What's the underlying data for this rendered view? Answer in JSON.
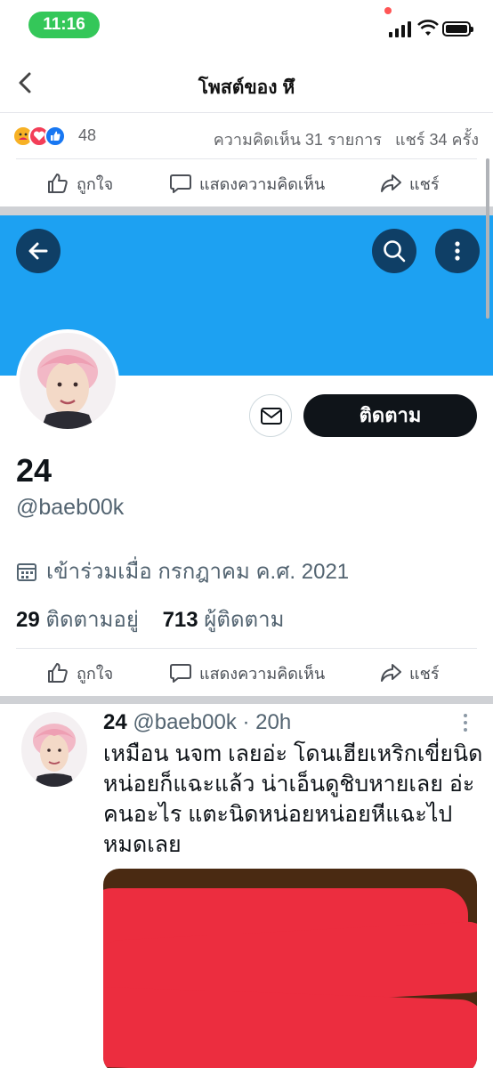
{
  "status_bar": {
    "time": "11:16"
  },
  "header": {
    "title": "โพสต์ของ หึ"
  },
  "reactions": {
    "count": "48",
    "comments_text": "ความคิดเห็น 31 รายการ",
    "shares_text": "แชร์ 34 ครั้ง"
  },
  "actions": {
    "like": "ถูกใจ",
    "comment": "แสดงความคิดเห็น",
    "share": "แชร์"
  },
  "profile": {
    "name": "24",
    "handle": "@baeb00k",
    "follow_label": "ติดตาม",
    "joined": "เข้าร่วมเมื่อ กรกฎาคม ค.ศ. 2021",
    "following_count": "29",
    "following_label": "ติดตามอยู่",
    "followers_count": "713",
    "followers_label": "ผู้ติดตาม"
  },
  "tweet": {
    "name": "24",
    "handle_time": "@baeb00k · 20h",
    "text": "เหมือน นจm เลยอ่ะ โดนเฮียเหริกเขี่ยนิดหน่อยก็แฉะแล้ว น่าเอ็นดูชิบหายเลย อ่ะคนอะไร แตะนิดหน่อยหน่อยหีแฉะไปหมดเลย"
  },
  "colors": {
    "twitter_blue": "#1da1f2",
    "dark_button": "#0f1419",
    "status_green": "#34c759",
    "redaction": "#ec2d3f"
  },
  "icons": [
    "back-chevron-icon",
    "like-icon",
    "love-icon",
    "care-icon",
    "thumbs-up-icon",
    "comment-icon",
    "share-icon",
    "arrow-left-icon",
    "search-icon",
    "more-vertical-icon",
    "mail-icon",
    "calendar-icon"
  ]
}
